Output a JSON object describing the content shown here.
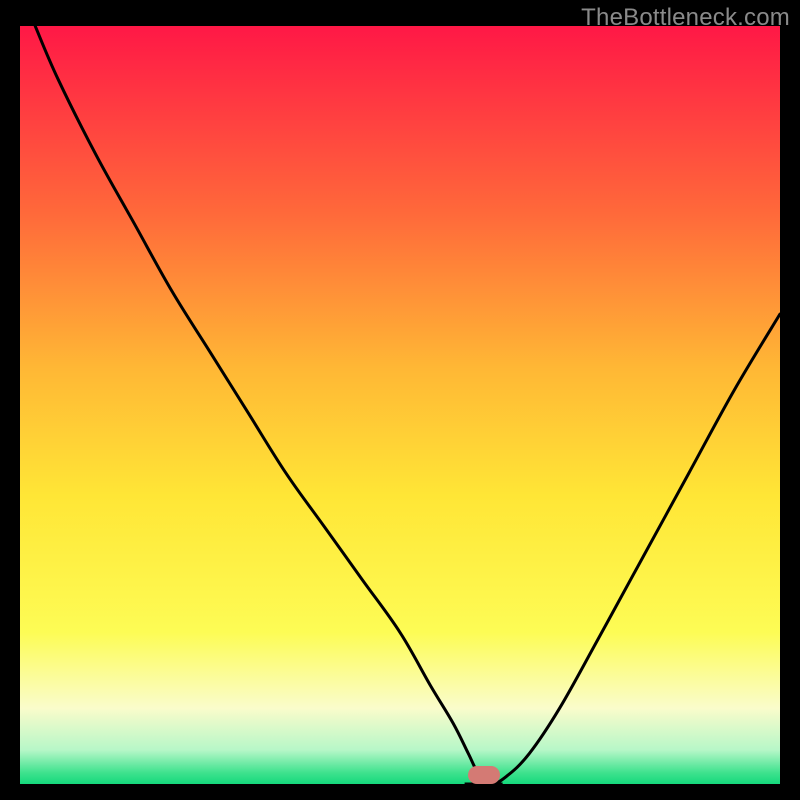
{
  "watermark": "TheBottleneck.com",
  "chart_data": {
    "type": "line",
    "title": "",
    "xlabel": "",
    "ylabel": "",
    "xlim": [
      0,
      100
    ],
    "ylim": [
      0,
      100
    ],
    "grid": false,
    "legend": false,
    "series": [
      {
        "name": "bottleneck-curve",
        "x": [
          2,
          5,
          10,
          15,
          20,
          25,
          30,
          35,
          40,
          45,
          50,
          54,
          57,
          59,
          60.5,
          62,
          64,
          67,
          71,
          76,
          82,
          88,
          94,
          100
        ],
        "y": [
          100,
          93,
          83,
          74,
          65,
          57,
          49,
          41,
          34,
          27,
          20,
          13,
          8,
          4,
          1,
          0,
          1,
          4,
          10,
          19,
          30,
          41,
          52,
          62
        ]
      }
    ],
    "plateau": {
      "x_start": 58.5,
      "x_end": 63.5,
      "y": 0
    },
    "marker": {
      "x": 61,
      "y": 0
    },
    "background_gradient": {
      "stops": [
        {
          "offset": 0.0,
          "color": "#ff1846"
        },
        {
          "offset": 0.25,
          "color": "#ff6a3a"
        },
        {
          "offset": 0.45,
          "color": "#ffb735"
        },
        {
          "offset": 0.62,
          "color": "#ffe636"
        },
        {
          "offset": 0.8,
          "color": "#fdfc55"
        },
        {
          "offset": 0.9,
          "color": "#fafccb"
        },
        {
          "offset": 0.955,
          "color": "#b7f7c8"
        },
        {
          "offset": 0.985,
          "color": "#3fe28e"
        },
        {
          "offset": 1.0,
          "color": "#15d97c"
        }
      ]
    }
  },
  "colors": {
    "curve": "#000000",
    "frame": "#000000",
    "marker": "#d47a74",
    "watermark": "#8a8a8a"
  }
}
